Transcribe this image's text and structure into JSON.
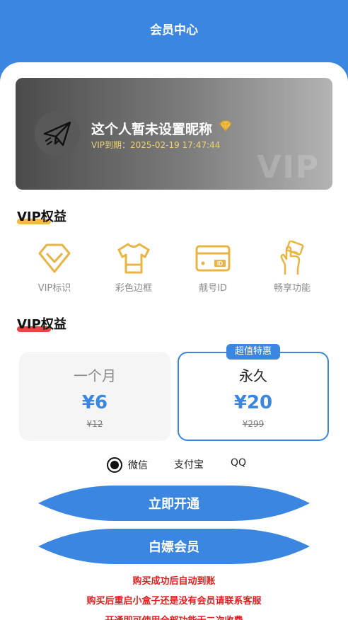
{
  "header": {
    "title": "会员中心"
  },
  "profile": {
    "nickname": "这个人暂未设置昵称",
    "vip_expire": "VIP到期：2025-02-19 17:47:44",
    "watermark": "VIP"
  },
  "benefits_section": {
    "title": "VIP权益",
    "highlight_color": "#f2b84b",
    "items": [
      {
        "label": "VIP标识",
        "icon": "diamond-icon"
      },
      {
        "label": "彩色边框",
        "icon": "tshirt-icon"
      },
      {
        "label": "靓号ID",
        "icon": "id-card-icon"
      },
      {
        "label": "畅享功能",
        "icon": "hand-card-icon"
      }
    ],
    "icon_color": "#e8b443"
  },
  "plans_section": {
    "title": "VIP权益",
    "highlight_color": "#e84545",
    "badge": "超值特惠",
    "plans": [
      {
        "name": "一个月",
        "price": "¥6",
        "original": "¥12",
        "selected": false
      },
      {
        "name": "永久",
        "price": "¥20",
        "original": "¥299",
        "selected": true
      }
    ]
  },
  "payment": {
    "options": [
      {
        "label": "微信",
        "selected": true
      },
      {
        "label": "支付宝",
        "selected": false
      },
      {
        "label": "QQ",
        "selected": false
      }
    ]
  },
  "buttons": {
    "activate": "立即开通",
    "free_member": "白嫖会员"
  },
  "notes": [
    "购买成功后自动到账",
    "购买后重启小盒子还是没有会员请联系客服",
    "开通即可使用全部功能无二次收费"
  ],
  "colors": {
    "primary": "#3a86e0",
    "note_red": "#e02020"
  }
}
